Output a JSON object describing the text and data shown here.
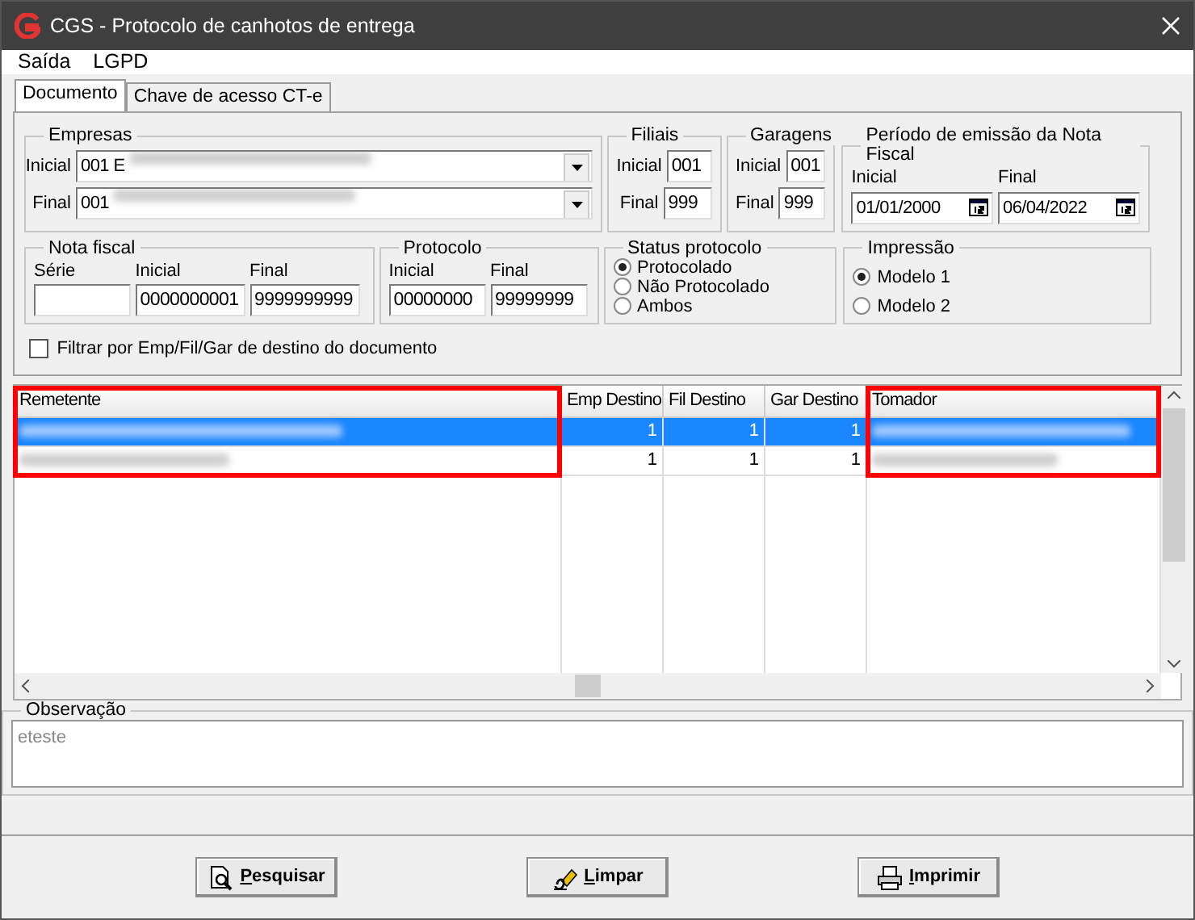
{
  "window": {
    "title": "CGS - Protocolo de canhotos de entrega"
  },
  "menu": [
    "Saída",
    "LGPD"
  ],
  "tabs": [
    {
      "label": "Documento",
      "selected": true
    },
    {
      "label": "Chave de acesso CT-e",
      "selected": false
    }
  ],
  "empresas": {
    "title": "Empresas",
    "rows": [
      {
        "label": "Inicial",
        "value": "001 E"
      },
      {
        "label": "Final",
        "value": "001"
      }
    ]
  },
  "filiais": {
    "title": "Filiais",
    "rows": [
      {
        "label": "Inicial",
        "value": "001"
      },
      {
        "label": "Final",
        "value": "999"
      }
    ]
  },
  "garagens": {
    "title": "Garagens",
    "rows": [
      {
        "label": "Inicial",
        "value": "001"
      },
      {
        "label": "Final",
        "value": "999"
      }
    ]
  },
  "periodo": {
    "title": "Período de emissão da Nota Fiscal",
    "fields": [
      {
        "label": "Inicial",
        "value": "01/01/2000"
      },
      {
        "label": "Final",
        "value": "06/04/2022"
      }
    ]
  },
  "nota_fiscal": {
    "title": "Nota fiscal",
    "fields": [
      {
        "label": "Série"
      },
      {
        "label": "Inicial",
        "value": "0000000001"
      },
      {
        "label": "Final",
        "value": "9999999999"
      }
    ]
  },
  "protocolo": {
    "title": "Protocolo",
    "fields": [
      {
        "label": "Inicial",
        "value": "00000000"
      },
      {
        "label": "Final",
        "value": "99999999"
      }
    ]
  },
  "status_protocolo": {
    "title": "Status protocolo",
    "options": [
      {
        "label": "Protocolado",
        "selected": true
      },
      {
        "label": "Não Protocolado",
        "selected": false
      },
      {
        "label": "Ambos",
        "selected": false
      }
    ]
  },
  "impressao": {
    "title": "Impressão",
    "options": [
      {
        "label": "Modelo 1",
        "selected": true
      },
      {
        "label": "Modelo 2",
        "selected": false
      }
    ]
  },
  "filter_checkbox": {
    "label": "Filtrar por Emp/Fil/Gar de destino do documento",
    "checked": false
  },
  "table": {
    "columns": [
      {
        "label": "Remetente",
        "highlighted": true
      },
      {
        "label": "Emp Destino",
        "highlighted": false
      },
      {
        "label": "Fil Destino",
        "highlighted": false
      },
      {
        "label": "Gar Destino",
        "highlighted": false
      },
      {
        "label": "Tomador",
        "highlighted": true
      }
    ],
    "rows": [
      {
        "selected": true,
        "cells": [
          null,
          "1",
          "1",
          "1",
          null
        ]
      },
      {
        "selected": false,
        "cells": [
          null,
          "1",
          "1",
          "1",
          null
        ]
      }
    ]
  },
  "observacao": {
    "title": "Observação",
    "value": "eteste",
    "disabled": true
  },
  "buttons": [
    {
      "label": "Pesquisar",
      "kind": "search"
    },
    {
      "label": "Limpar",
      "kind": "eraser"
    },
    {
      "label": "Imprimir",
      "kind": "printer"
    }
  ]
}
